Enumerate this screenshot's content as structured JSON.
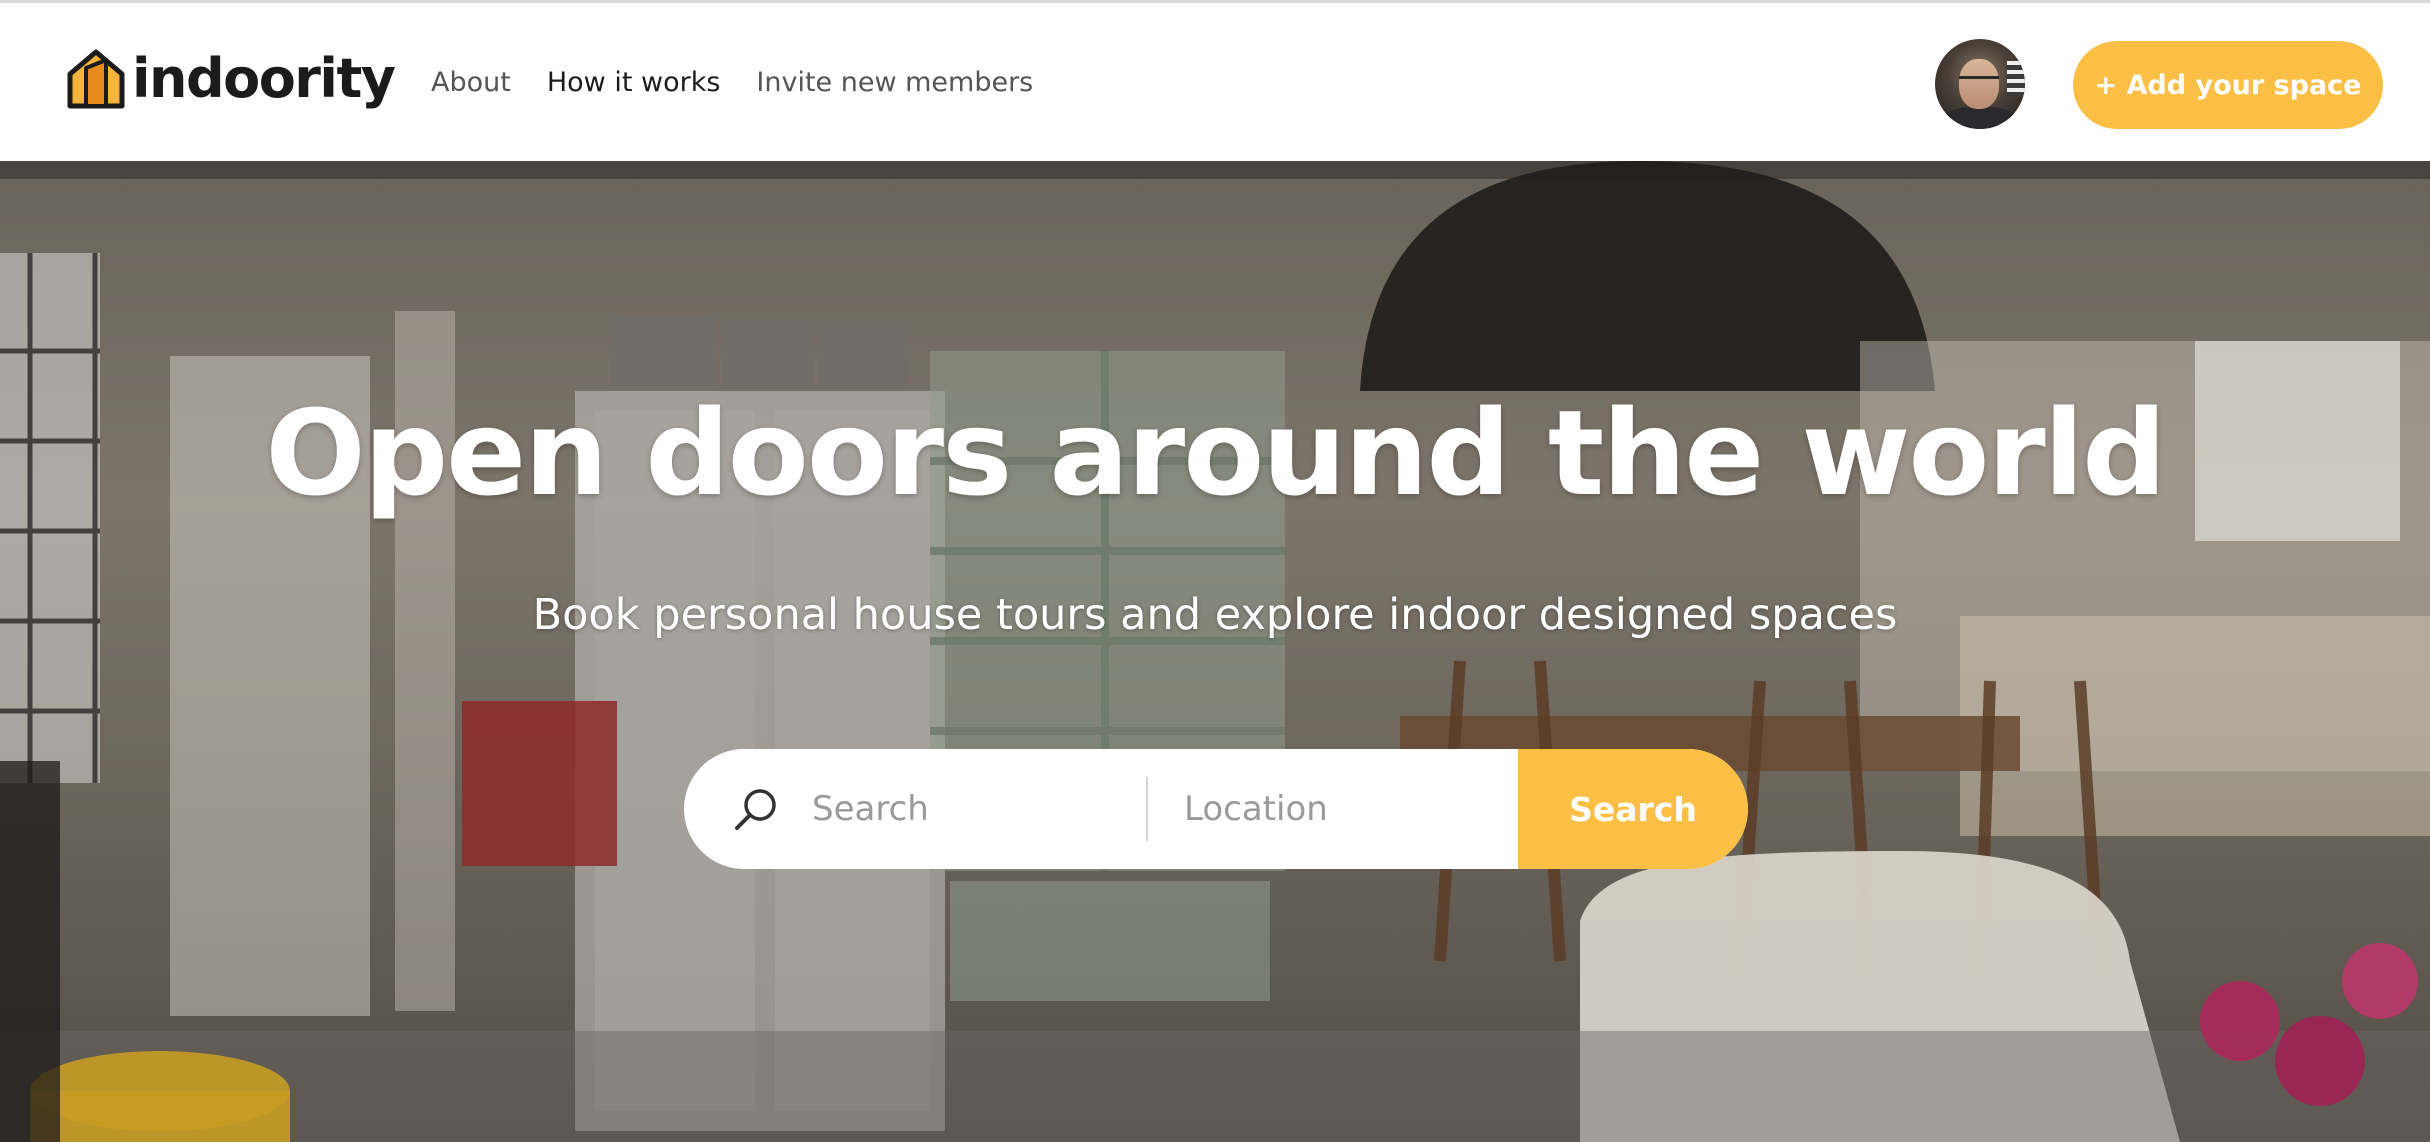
{
  "brand": {
    "name": "indoority",
    "logo_icon": "house-door-icon",
    "accent_color": "#fbbf45"
  },
  "nav": {
    "links": [
      {
        "label": "About"
      },
      {
        "label": "How it works"
      },
      {
        "label": "Invite new members"
      }
    ]
  },
  "user": {
    "avatar_icon": "user-avatar"
  },
  "actions": {
    "add_space_label": "+ Add your space"
  },
  "hero": {
    "title": "Open doors around the world",
    "subtitle": "Book personal house tours and explore indoor designed spaces",
    "background": "loft-interior-photo"
  },
  "search": {
    "icon": "search-icon",
    "query_placeholder": "Search",
    "location_placeholder": "Location",
    "button_label": "Search"
  }
}
